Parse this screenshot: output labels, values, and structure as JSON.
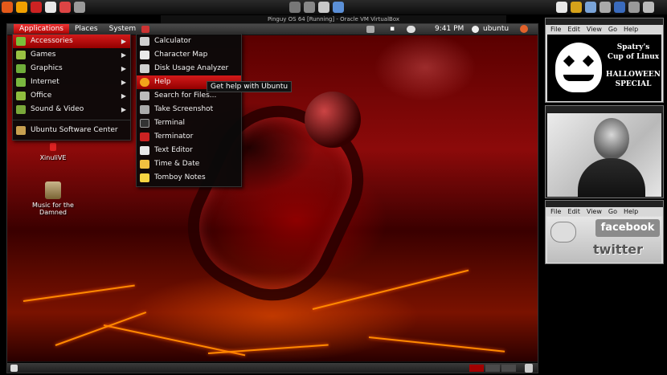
{
  "vm_title": "Pinguy OS 64 [Running] - Oracle VM VirtualBox",
  "guest_panel": {
    "menus": [
      "Applications",
      "Places",
      "System"
    ],
    "clock": "9:41 PM",
    "user": "ubuntu"
  },
  "applications_menu": {
    "items": [
      {
        "label": "Accessories",
        "icon": "accessories-icon",
        "has_submenu": true,
        "highlighted": true
      },
      {
        "label": "Games",
        "icon": "games-icon",
        "has_submenu": true
      },
      {
        "label": "Graphics",
        "icon": "graphics-icon",
        "has_submenu": true
      },
      {
        "label": "Internet",
        "icon": "internet-icon",
        "has_submenu": true
      },
      {
        "label": "Office",
        "icon": "office-icon",
        "has_submenu": true
      },
      {
        "label": "Sound & Video",
        "icon": "sound-video-icon",
        "has_submenu": true
      }
    ],
    "footer_item": {
      "label": "Ubuntu Software Center",
      "icon": "software-center-icon"
    }
  },
  "accessories_menu": {
    "items": [
      {
        "label": "Calculator",
        "icon": "calculator-icon",
        "color": "#cfcfcf"
      },
      {
        "label": "Character Map",
        "icon": "character-map-icon",
        "color": "#e8e8e8"
      },
      {
        "label": "Disk Usage Analyzer",
        "icon": "disk-usage-icon",
        "color": "#d0d0d0"
      },
      {
        "label": "Help",
        "icon": "help-icon",
        "color": "#f2a21a",
        "highlighted": true
      },
      {
        "label": "Search for Files...",
        "icon": "search-files-icon",
        "color": "#bbbbbb"
      },
      {
        "label": "Take Screenshot",
        "icon": "screenshot-icon",
        "color": "#aaaaaa"
      },
      {
        "label": "Terminal",
        "icon": "terminal-icon",
        "color": "#333333"
      },
      {
        "label": "Terminator",
        "icon": "terminator-icon",
        "color": "#cc2222"
      },
      {
        "label": "Text Editor",
        "icon": "text-editor-icon",
        "color": "#e8e8e8"
      },
      {
        "label": "Time & Date",
        "icon": "time-date-icon",
        "color": "#f0c040"
      },
      {
        "label": "Tomboy Notes",
        "icon": "tomboy-notes-icon",
        "color": "#f5d542"
      }
    ]
  },
  "tooltip": "Get help with Ubuntu",
  "desktop_icons": [
    {
      "label": "XinuliVE",
      "icon": "xinulive-icon"
    },
    {
      "label": "Music for the Damned",
      "icon": "music-folder-icon"
    }
  ],
  "right_windows": {
    "menu": [
      "File",
      "Edit",
      "View",
      "Go",
      "Help"
    ],
    "poster": {
      "line1": "Spatry's",
      "line2": "Cup of Linux",
      "line3": "HALLOWEEN",
      "line4": "SPECIAL"
    },
    "social": {
      "facebook": "facebook",
      "twitter": "twitter"
    }
  },
  "colors": {
    "accent": "#c40000",
    "panel": "#2b2b2b",
    "menu_bg": "#0a0a0a"
  }
}
